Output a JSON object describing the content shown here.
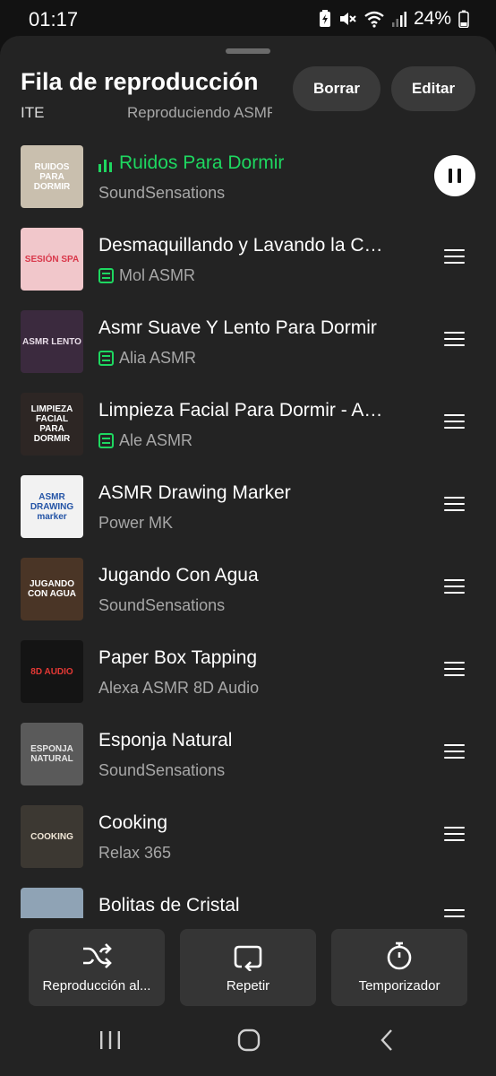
{
  "status_bar": {
    "time": "01:17",
    "battery_percent": "24%",
    "icons": [
      "battery-saver-icon",
      "mute-icon",
      "wifi-icon",
      "signal-icon",
      "battery-icon"
    ]
  },
  "header": {
    "title": "Fila de reproducción",
    "clear_label": "Borrar",
    "edit_label": "Editar",
    "context_left": "ITE",
    "context_right": "Reproduciendo ASMR"
  },
  "queue": [
    {
      "title": "Ruidos Para Dormir",
      "artist": "SoundSensations",
      "playing": true,
      "downloaded": false,
      "thumb_text": "RUIDOS PARA DORMIR",
      "thumb_bg": "#c9bfae",
      "thumb_fg": "#ffffff"
    },
    {
      "title": "Desmaquillando y Lavando la Cara para Dormir",
      "artist": "Mol ASMR",
      "playing": false,
      "downloaded": true,
      "thumb_text": "SESIÓN SPA",
      "thumb_bg": "#f1c7cb",
      "thumb_fg": "#d9374a"
    },
    {
      "title": "Asmr Suave Y Lento Para Dormir",
      "artist": "Alia ASMR",
      "playing": false,
      "downloaded": true,
      "thumb_text": "ASMR LENTO",
      "thumb_bg": "#3b2a3e",
      "thumb_fg": "#e8dde8"
    },
    {
      "title": "Limpieza Facial Para Dormir - ASMR",
      "artist": "Ale ASMR",
      "playing": false,
      "downloaded": true,
      "thumb_text": "LIMPIEZA FACIAL PARA DORMIR",
      "thumb_bg": "#2d2624",
      "thumb_fg": "#ffffff"
    },
    {
      "title": "ASMR Drawing Marker",
      "artist": "Power MK",
      "playing": false,
      "downloaded": false,
      "thumb_text": "ASMR DRAWING marker",
      "thumb_bg": "#f2f2f2",
      "thumb_fg": "#2454a6"
    },
    {
      "title": "Jugando Con Agua",
      "artist": "SoundSensations",
      "playing": false,
      "downloaded": false,
      "thumb_text": "JUGANDO CON AGUA",
      "thumb_bg": "#4a3526",
      "thumb_fg": "#ffffff"
    },
    {
      "title": "Paper Box Tapping",
      "artist": "Alexa ASMR 8D Audio",
      "playing": false,
      "downloaded": false,
      "thumb_text": "8D AUDIO",
      "thumb_bg": "#141414",
      "thumb_fg": "#e53935"
    },
    {
      "title": "Esponja Natural",
      "artist": "SoundSensations",
      "playing": false,
      "downloaded": false,
      "thumb_text": "ESPONJA NATURAL",
      "thumb_bg": "#5a5a5a",
      "thumb_fg": "#e6e6e6"
    },
    {
      "title": "Cooking",
      "artist": "Relax 365",
      "playing": false,
      "downloaded": false,
      "thumb_text": "COOKING",
      "thumb_bg": "#3c3832",
      "thumb_fg": "#f0e6d6"
    },
    {
      "title": "Bolitas de Cristal",
      "artist": "",
      "playing": false,
      "downloaded": false,
      "thumb_text": "",
      "thumb_bg": "#8fa3b5",
      "thumb_fg": "#ffffff"
    }
  ],
  "controls": {
    "shuffle_label": "Reproducción al...",
    "repeat_label": "Repetir",
    "timer_label": "Temporizador"
  },
  "colors": {
    "accent": "#1ed760",
    "sheet_bg": "#232323",
    "button_bg": "#3a3a3a"
  }
}
